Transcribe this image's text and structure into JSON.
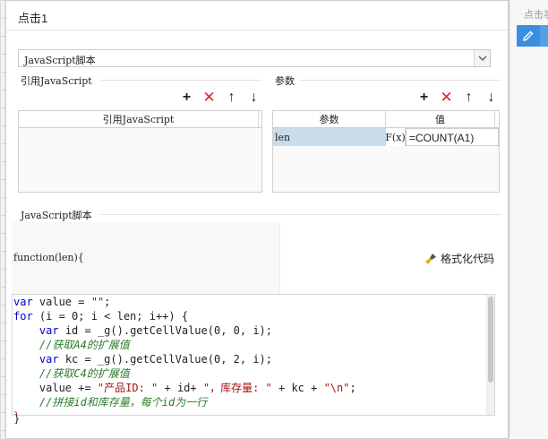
{
  "side_panel": {
    "hint": "点击事",
    "edit_icon": "pencil-icon"
  },
  "dialog": {
    "title": "点击1"
  },
  "script_type": {
    "selected": "JavaScript脚本"
  },
  "ref_js": {
    "title": "引用JavaScript",
    "column": "引用JavaScript",
    "toolbar": {
      "add": "+",
      "delete": "✕",
      "up": "↑",
      "down": "↓"
    }
  },
  "params": {
    "title": "参数",
    "columns": [
      "参数",
      "值"
    ],
    "toolbar": {
      "add": "+",
      "delete": "✕",
      "up": "↑",
      "down": "↓"
    },
    "rows": [
      {
        "name": "len",
        "fx": "F(x)",
        "value": "=COUNT(A1)"
      }
    ]
  },
  "script": {
    "title": "JavaScript脚本",
    "signature": "function(len){",
    "format_button": "格式化代码",
    "closing": "}",
    "code_lines": [
      "var value = \"\";",
      "for (i = 0; i < len; i++) {",
      "    var id = _g().getCellValue(0, 0, i);",
      "    //获取A4的扩展值",
      "    var kc = _g().getCellValue(0, 2, i);",
      "    //获取C4的扩展值",
      "    value += \"产品ID: \" + id+ \"，库存量: \" + kc + \"\\n\";",
      "    //拼接id和库存量，每个id为一行",
      "}"
    ]
  },
  "colors": {
    "accent": "#3a8fe0",
    "delete_red": "#e0242a",
    "keyword": "#0000cc",
    "string": "#a31515",
    "comment": "#2c7c2c",
    "selected_cell": "#c9dcec"
  }
}
